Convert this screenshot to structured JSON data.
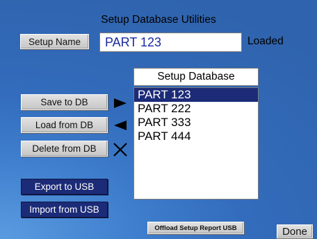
{
  "title": "Setup Database Utilities",
  "setup_name": {
    "button_label": "Setup Name",
    "value": "PART 123",
    "status": "Loaded"
  },
  "database": {
    "header": "Setup Database",
    "items": [
      "PART 123",
      "PART 222",
      "PART 333",
      "PART 444"
    ],
    "selected_index": 0
  },
  "actions": {
    "save": "Save to DB",
    "load": "Load from DB",
    "delete": "Delete from DB",
    "export": "Export to USB",
    "import": "Import from USB",
    "offload": "Offload Setup Report USB",
    "done": "Done"
  },
  "icons": {
    "save": "play-right-icon",
    "load": "play-left-icon",
    "delete": "x-delete-icon"
  },
  "colors": {
    "selection": "#1c2b77",
    "field_text": "#1b2a9e",
    "nav_button": "#1c2b77"
  }
}
